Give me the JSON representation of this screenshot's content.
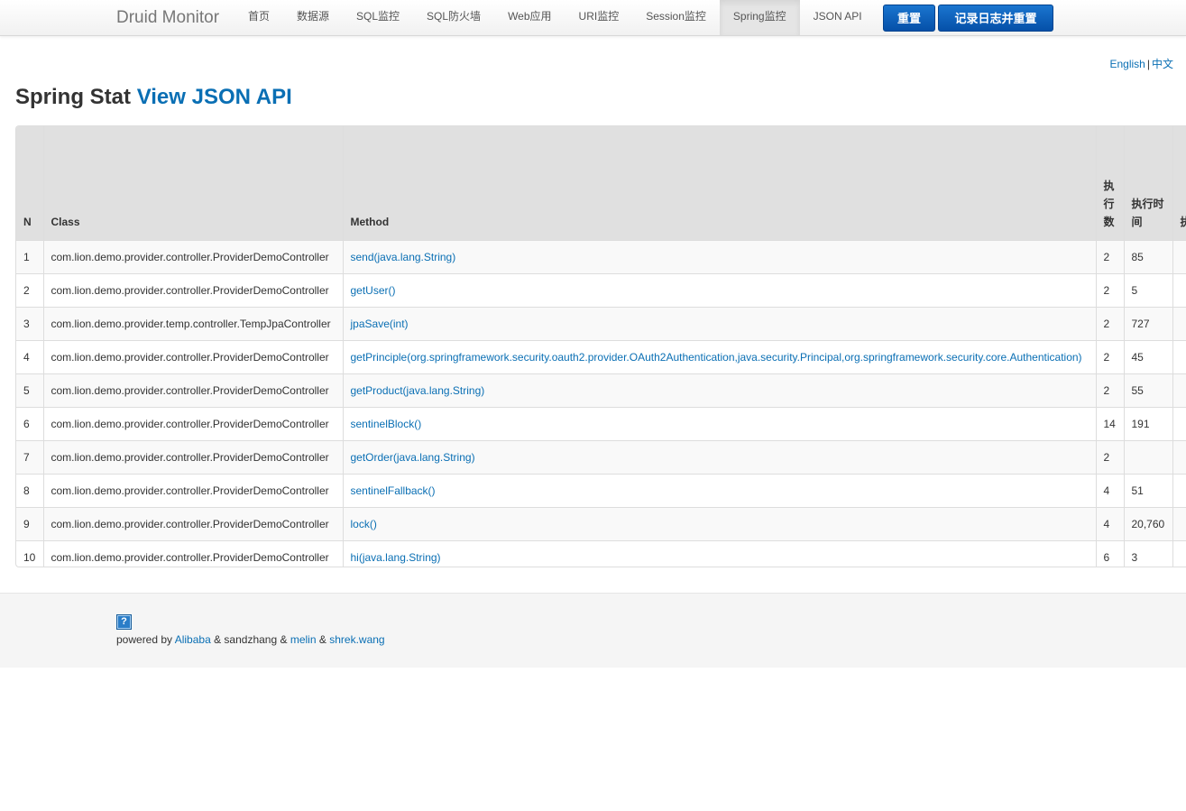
{
  "navbar": {
    "brand": "Druid Monitor",
    "items": [
      "首页",
      "数据源",
      "SQL监控",
      "SQL防火墙",
      "Web应用",
      "URI监控",
      "Session监控",
      "Spring监控",
      "JSON API"
    ],
    "active_index": 7,
    "reset_button": "重置",
    "log_reset_button": "记录日志并重置"
  },
  "lang": {
    "english": "English",
    "separator": "|",
    "chinese": "中文"
  },
  "page": {
    "title": "Spring Stat",
    "title_link": "View JSON API"
  },
  "table": {
    "headers": [
      "N",
      "Class",
      "Method",
      "执行数",
      "执行时间",
      "执行中"
    ],
    "rows": [
      [
        "1",
        "com.lion.demo.provider.controller.ProviderDemoController",
        "send(java.lang.String)",
        "2",
        "85"
      ],
      [
        "2",
        "com.lion.demo.provider.controller.ProviderDemoController",
        "getUser()",
        "2",
        "5"
      ],
      [
        "3",
        "com.lion.demo.provider.temp.controller.TempJpaController",
        "jpaSave(int)",
        "2",
        "727"
      ],
      [
        "4",
        "com.lion.demo.provider.controller.ProviderDemoController",
        "getPrinciple(org.springframework.security.oauth2.provider.OAuth2Authentication,java.security.Principal,org.springframework.security.core.Authentication)",
        "2",
        "45"
      ],
      [
        "5",
        "com.lion.demo.provider.controller.ProviderDemoController",
        "getProduct(java.lang.String)",
        "2",
        "55"
      ],
      [
        "6",
        "com.lion.demo.provider.controller.ProviderDemoController",
        "sentinelBlock()",
        "14",
        "191"
      ],
      [
        "7",
        "com.lion.demo.provider.controller.ProviderDemoController",
        "getOrder(java.lang.String)",
        "2",
        ""
      ],
      [
        "8",
        "com.lion.demo.provider.controller.ProviderDemoController",
        "sentinelFallback()",
        "4",
        "51"
      ],
      [
        "9",
        "com.lion.demo.provider.controller.ProviderDemoController",
        "lock()",
        "4",
        "20,760"
      ],
      [
        "10",
        "com.lion.demo.provider.controller.ProviderDemoController",
        "hi(java.lang.String)",
        "6",
        "3"
      ]
    ]
  },
  "footer": {
    "help_icon": "?",
    "powered_by": "powered by",
    "alibaba": "Alibaba",
    "sandzhang": "& sandzhang &",
    "melin": "melin",
    "amp": "&",
    "shrek": "shrek.wang"
  }
}
